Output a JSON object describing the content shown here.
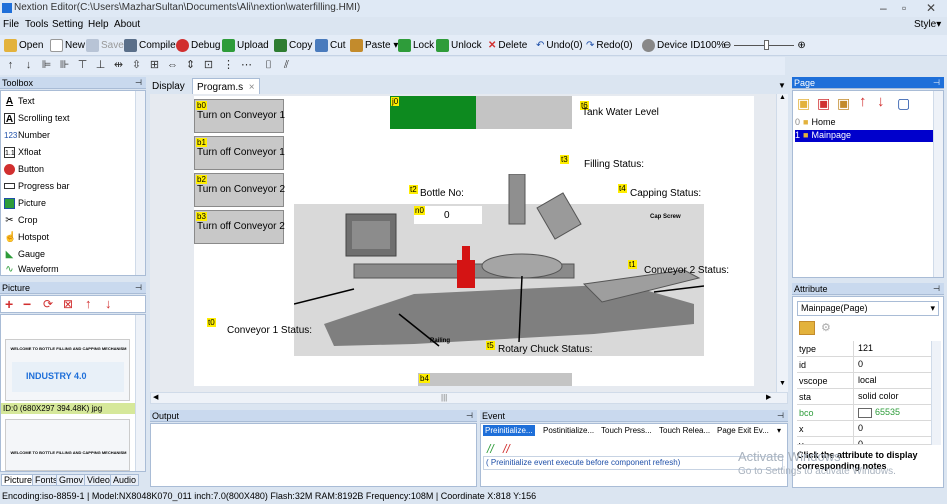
{
  "window": {
    "title": "Nextion Editor(C:\\Users\\MazharSultan\\Documents\\Ali\\nextion\\waterfilling.HMI)",
    "minimize": "–",
    "restore": "▫",
    "close": "✕"
  },
  "menu": [
    "File",
    "Tools",
    "Setting",
    "Help",
    "About"
  ],
  "menu_style": "Style▾",
  "toolbar": {
    "open": "Open",
    "new": "New",
    "save": "Save",
    "compile": "Compile",
    "debug": "Debug",
    "upload": "Upload",
    "copy": "Copy",
    "cut": "Cut",
    "paste": "Paste",
    "lock": "Lock",
    "unlock": "Unlock",
    "delete": "Delete",
    "undo": "Undo(0)",
    "redo": "Redo(0)",
    "device_id": "Device ID",
    "zoom": "100%"
  },
  "toolbox": {
    "title": "Toolbox",
    "items": [
      "Text",
      "Scrolling text",
      "Number",
      "Xfloat",
      "Button",
      "Progress bar",
      "Picture",
      "Crop",
      "Hotspot",
      "Gauge",
      "Waveform"
    ]
  },
  "picture_panel": {
    "title": "Picture",
    "caption": "ID:0  (680X297 394.48K) jpg",
    "thumb_text": "WELCOME TO BOTTLE FILLING AND CAPPING MECHANISM",
    "industry_text": "INDUSTRY 4.0"
  },
  "bottom_tabs": [
    "Picture",
    "Fonts",
    "Gmov",
    "Video",
    "Audio"
  ],
  "doc_tabs": {
    "display": "Display",
    "program": "Program.s",
    "close": "×"
  },
  "canvas": {
    "buttons": [
      {
        "tag": "b0",
        "label": "Turn on Conveyor 1"
      },
      {
        "tag": "b1",
        "label": "Turn off Conveyor 1"
      },
      {
        "tag": "b2",
        "label": "Turn on Conveyor 2"
      },
      {
        "tag": "b3",
        "label": "Turn off Conveyor 2"
      }
    ],
    "progress_tag": "j0",
    "progress_value": 0.47,
    "t6": {
      "tag": "t6",
      "text": "Tank Water Level"
    },
    "t3": {
      "tag": "t3",
      "text": "Filling Status:"
    },
    "t2": {
      "tag": "t2",
      "text": "Bottle No:"
    },
    "n0": {
      "tag": "n0",
      "text": "0"
    },
    "t4": {
      "tag": "t4",
      "text": "Capping Status:"
    },
    "cap_screw": "Cap Screw",
    "t1": {
      "tag": "t1",
      "text": "Conveyor 2 Status:"
    },
    "t0": {
      "tag": "t0",
      "text": "Conveyor 1 Status:"
    },
    "railing": "Railing",
    "t5": {
      "tag": "t5",
      "text": "Rotary Chuck Status:"
    },
    "b4": "b4"
  },
  "output_title": "Output",
  "event": {
    "title": "Event",
    "tabs": [
      "Preinitialize...",
      "Postinitialize...",
      "Touch Press...",
      "Touch Relea...",
      "Page Exit Ev..."
    ],
    "hint": "( Preinitialize event execute before component refresh)"
  },
  "page_panel": {
    "title": "Page",
    "pages": [
      {
        "id": "0",
        "name": "Home"
      },
      {
        "id": "1",
        "name": "Mainpage"
      }
    ]
  },
  "attribute_panel": {
    "title": "Attribute",
    "selected": "Mainpage(Page)",
    "rows": [
      {
        "k": "type",
        "v": "121"
      },
      {
        "k": "id",
        "v": "0"
      },
      {
        "k": "vscope",
        "v": "local"
      },
      {
        "k": "sta",
        "v": "solid color"
      },
      {
        "k": "bco",
        "v": "65535"
      },
      {
        "k": "x",
        "v": "0"
      },
      {
        "k": "y",
        "v": "0"
      }
    ],
    "note": "Click the attribute to display corresponding notes"
  },
  "watermark": {
    "line1": "Activate Windows",
    "line2": "Go to Settings to activate Windows."
  },
  "status": "Encoding:iso-8859-1 | Model:NX8048K070_011  inch:7.0(800X480) Flash:32M RAM:8192B Frequency:108M |    Coordinate X:818  Y:156",
  "colors": {
    "accent": "#1e6fd9",
    "progress_fill": "#0d8a1f",
    "progress_bg": "#c4c4c4",
    "selected": "#0000cc"
  }
}
